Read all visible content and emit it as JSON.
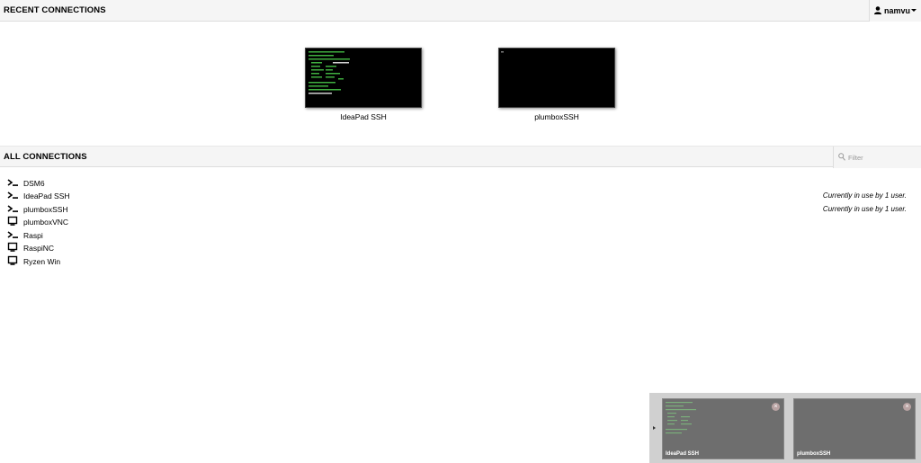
{
  "header": {
    "recent_title": "RECENT CONNECTIONS",
    "username": "namvu"
  },
  "recent": [
    {
      "label": "IdeaPad SSH"
    },
    {
      "label": "plumboxSSH"
    }
  ],
  "all": {
    "title": "ALL CONNECTIONS",
    "filter_placeholder": "Filter",
    "connections": [
      {
        "name": "DSM6",
        "icon": "terminal-icon",
        "status": ""
      },
      {
        "name": "IdeaPad SSH",
        "icon": "terminal-icon",
        "status": "Currently in use by 1 user."
      },
      {
        "name": "plumboxSSH",
        "icon": "terminal-icon",
        "status": "Currently in use by 1 user."
      },
      {
        "name": "plumboxVNC",
        "icon": "desktop-icon",
        "status": ""
      },
      {
        "name": "Raspi",
        "icon": "terminal-icon",
        "status": ""
      },
      {
        "name": "RaspiNC",
        "icon": "desktop-icon",
        "status": ""
      },
      {
        "name": "Ryzen Win",
        "icon": "desktop-icon",
        "status": ""
      }
    ]
  },
  "clients": [
    {
      "label": "IdeaPad SSH"
    },
    {
      "label": "plumboxSSH"
    }
  ]
}
